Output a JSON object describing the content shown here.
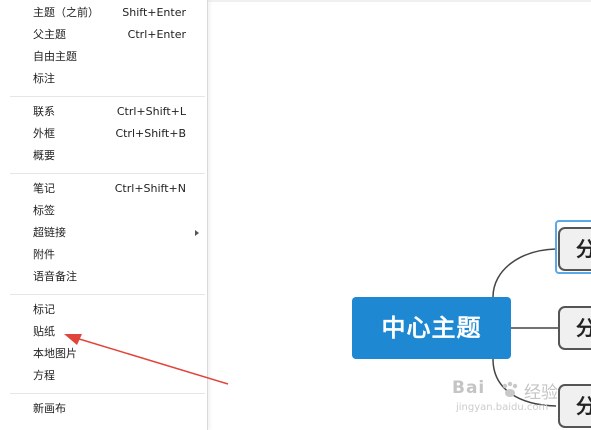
{
  "menu": {
    "groups": [
      [
        {
          "label": "主题（之前）",
          "shortcut": "Shift+Enter"
        },
        {
          "label": "父主题",
          "shortcut": "Ctrl+Enter"
        },
        {
          "label": "自由主题",
          "shortcut": ""
        },
        {
          "label": "标注",
          "shortcut": ""
        }
      ],
      [
        {
          "label": "联系",
          "shortcut": "Ctrl+Shift+L"
        },
        {
          "label": "外框",
          "shortcut": "Ctrl+Shift+B"
        },
        {
          "label": "概要",
          "shortcut": ""
        }
      ],
      [
        {
          "label": "笔记",
          "shortcut": "Ctrl+Shift+N"
        },
        {
          "label": "标签",
          "shortcut": ""
        },
        {
          "label": "超链接",
          "shortcut": "",
          "submenu": true
        },
        {
          "label": "附件",
          "shortcut": ""
        },
        {
          "label": "语音备注",
          "shortcut": ""
        }
      ],
      [
        {
          "label": "标记",
          "shortcut": ""
        },
        {
          "label": "贴纸",
          "shortcut": ""
        },
        {
          "label": "本地图片",
          "shortcut": ""
        },
        {
          "label": "方程",
          "shortcut": ""
        }
      ],
      [
        {
          "label": "新画布",
          "shortcut": ""
        }
      ]
    ]
  },
  "mindmap": {
    "central_topic": "中心主题",
    "branches": [
      "分",
      "分",
      "分"
    ]
  },
  "watermark": {
    "logo": "Bai",
    "cn": "经验",
    "url": "jingyan.baidu.com"
  },
  "colors": {
    "central_topic_bg": "#1e88d2",
    "selection": "#5aa8e6",
    "arrow": "#e0453a",
    "branch_border": "#555555",
    "branch_bg": "#f0f0f0"
  },
  "icons": {
    "submenu": "chevron-right-icon",
    "annotation": "red-arrow-annotation"
  }
}
